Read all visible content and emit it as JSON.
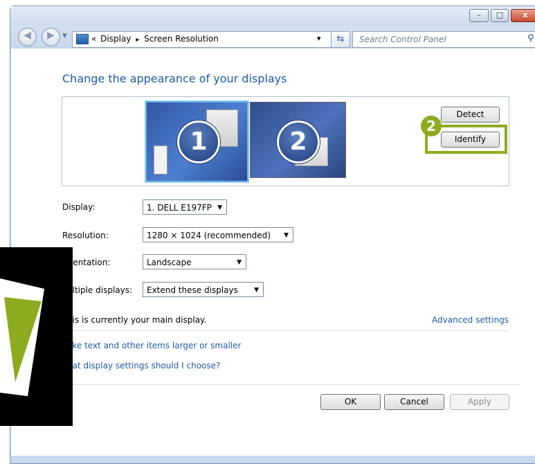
{
  "window": {
    "buttons": {
      "minimize": "–",
      "maximize": "□",
      "close": "x"
    }
  },
  "address": {
    "chevrons": "«",
    "crumb1": "Display",
    "arrow": "▸",
    "crumb2": "Screen Resolution",
    "dropdown": "▾",
    "refresh": "⇆",
    "search_placeholder": "Search Control Panel"
  },
  "main": {
    "heading": "Change the appearance of your displays",
    "monitor1_number": "1",
    "monitor2_number": "2",
    "detect_label": "Detect",
    "identify_label": "Identify",
    "step_badge": "2",
    "display_label": "Display:",
    "display_value": "1. DELL E197FP",
    "resolution_label": "Resolution:",
    "resolution_value": "1280 × 1024 (recommended)",
    "orientation_label": "rientation:",
    "orientation_value": "Landscape",
    "multiple_label": "ultiple displays:",
    "multiple_value": "Extend these displays",
    "main_display_text": "his is currently your main display.",
    "advanced_link": "Advanced settings",
    "link1": "ake text and other items larger or smaller",
    "link2": "hat display settings should I choose?",
    "ok_label": "OK",
    "cancel_label": "Cancel",
    "apply_label": "Apply"
  },
  "colors": {
    "highlight": "#8dab1f",
    "link": "#1e5aa8"
  }
}
